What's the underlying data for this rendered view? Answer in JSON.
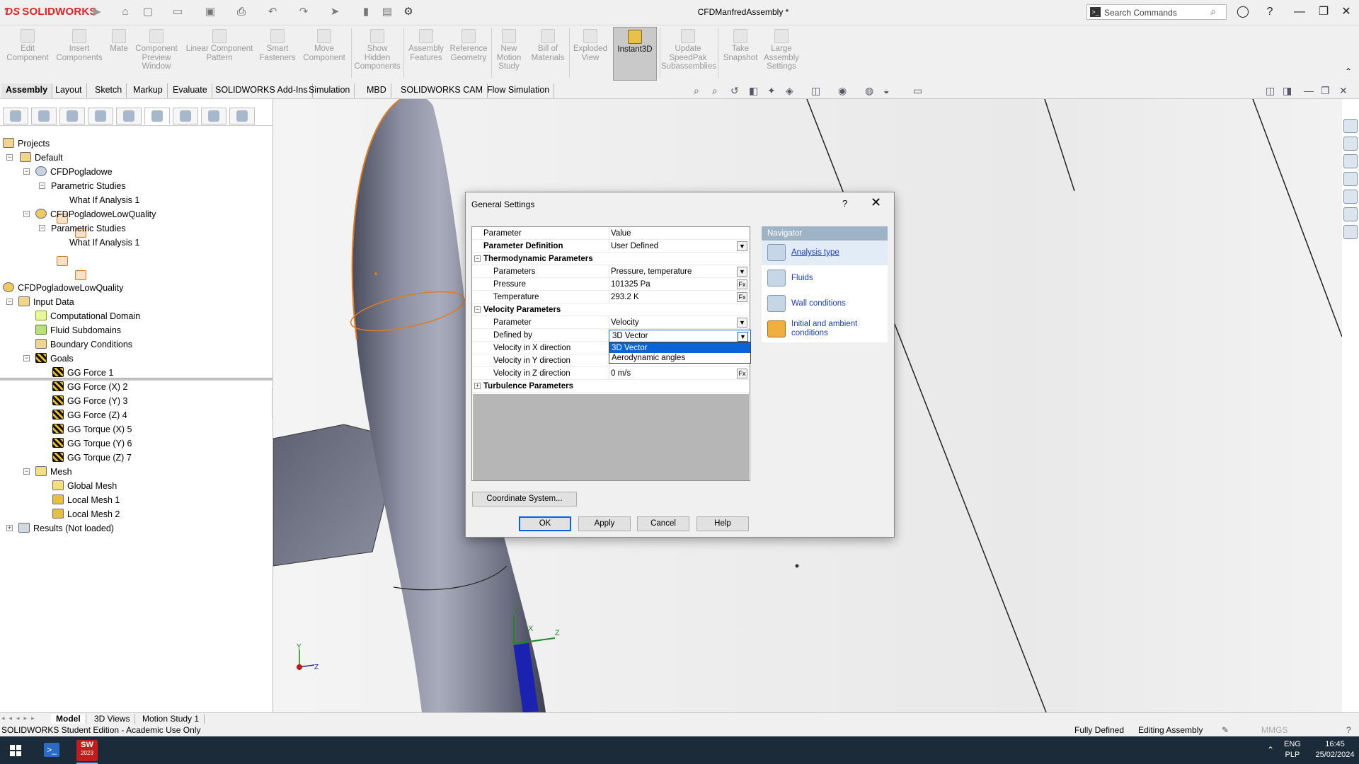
{
  "app": {
    "logo": "SOLIDWORKS",
    "doc_title": "CFDManfredAssembly *",
    "search_placeholder": "Search Commands"
  },
  "ribbon": {
    "buttons": [
      {
        "label": "Edit Component"
      },
      {
        "label": "Insert Components"
      },
      {
        "label": "Mate"
      },
      {
        "label": "Component Preview Window"
      },
      {
        "label": "Linear Component Pattern"
      },
      {
        "label": "Smart Fasteners"
      },
      {
        "label": "Move Component"
      },
      {
        "label": "Show Hidden Components"
      },
      {
        "label": "Assembly Features"
      },
      {
        "label": "Reference Geometry"
      },
      {
        "label": "New Motion Study"
      },
      {
        "label": "Bill of Materials"
      },
      {
        "label": "Exploded View"
      },
      {
        "label": "Instant3D"
      },
      {
        "label": "Update SpeedPak Subassemblies"
      },
      {
        "label": "Take Snapshot"
      },
      {
        "label": "Large Assembly Settings"
      }
    ]
  },
  "tabs": [
    "Assembly",
    "Layout",
    "Sketch",
    "Markup",
    "Evaluate",
    "SOLIDWORKS Add-Ins",
    "Simulation",
    "MBD",
    "SOLIDWORKS CAM",
    "Flow Simulation"
  ],
  "projects_tree": {
    "root": "Projects",
    "items": [
      {
        "label": "Default"
      },
      {
        "label": "CFDPogladowe"
      },
      {
        "label": "Parametric Studies"
      },
      {
        "label": "What If Analysis 1"
      },
      {
        "label": "CFDPogladoweLowQuality"
      },
      {
        "label": "Parametric Studies"
      },
      {
        "label": "What If Analysis 1"
      }
    ]
  },
  "analysis_tree": {
    "root": "CFDPogladoweLowQuality",
    "items": [
      {
        "label": "Input Data"
      },
      {
        "label": "Computational Domain"
      },
      {
        "label": "Fluid Subdomains"
      },
      {
        "label": "Boundary Conditions"
      },
      {
        "label": "Goals"
      },
      {
        "label": "GG Force 1"
      },
      {
        "label": "GG Force (X) 2"
      },
      {
        "label": "GG Force (Y) 3"
      },
      {
        "label": "GG Force (Z) 4"
      },
      {
        "label": "GG Torque (X) 5"
      },
      {
        "label": "GG Torque (Y) 6"
      },
      {
        "label": "GG Torque (Z) 7"
      },
      {
        "label": "Mesh"
      },
      {
        "label": "Global Mesh"
      },
      {
        "label": "Local Mesh 1"
      },
      {
        "label": "Local Mesh 2"
      },
      {
        "label": "Results (Not loaded)"
      }
    ]
  },
  "dialog": {
    "title": "General Settings",
    "help_glyph": "?",
    "close_glyph": "✕",
    "grid_header": {
      "param": "Parameter",
      "value": "Value"
    },
    "rows": [
      {
        "param": "Parameter Definition",
        "value": "User Defined"
      },
      {
        "param": "Thermodynamic Parameters",
        "value": ""
      },
      {
        "param": "Parameters",
        "value": "Pressure, temperature"
      },
      {
        "param": "Pressure",
        "value": "101325 Pa"
      },
      {
        "param": "Temperature",
        "value": "293.2 K"
      },
      {
        "param": "Velocity Parameters",
        "value": ""
      },
      {
        "param": "Parameter",
        "value": "Velocity"
      },
      {
        "param": "Defined by",
        "value": "3D Vector"
      },
      {
        "param": "Velocity in X direction",
        "value": ""
      },
      {
        "param": "Velocity in Y direction",
        "value": ""
      },
      {
        "param": "Velocity in Z direction",
        "value": "0 m/s"
      },
      {
        "param": "Turbulence Parameters",
        "value": ""
      }
    ],
    "fx_label": "Fx",
    "dropdown": {
      "selected": "3D Vector",
      "options": [
        "3D Vector",
        "Aerodynamic angles"
      ]
    },
    "coord_button": "Coordinate System...",
    "buttons": {
      "ok": "OK",
      "apply": "Apply",
      "cancel": "Cancel",
      "help": "Help"
    },
    "navigator": {
      "title": "Navigator",
      "items": [
        "Analysis type",
        "Fluids",
        "Wall conditions",
        "Initial and ambient conditions"
      ]
    }
  },
  "viewport": {
    "axes": {
      "x": "X",
      "y": "Y",
      "z": "Z"
    }
  },
  "bottom_tabs": [
    "Model",
    "3D Views",
    "Motion Study 1"
  ],
  "status": {
    "left": "SOLIDWORKS Student Edition - Academic Use Only",
    "defined": "Fully Defined",
    "mode": "Editing Assembly",
    "units": "MMGS"
  },
  "taskbar": {
    "lang": "ENG",
    "layout": "PLP",
    "time": "16:45",
    "date": "25/02/2024",
    "sw_badge": "2023"
  },
  "colors": {
    "accent": "#0a64d8",
    "logo_red": "#d22222",
    "navigator_header": "#9fb3c6",
    "taskbar": "#1c2b3a"
  }
}
